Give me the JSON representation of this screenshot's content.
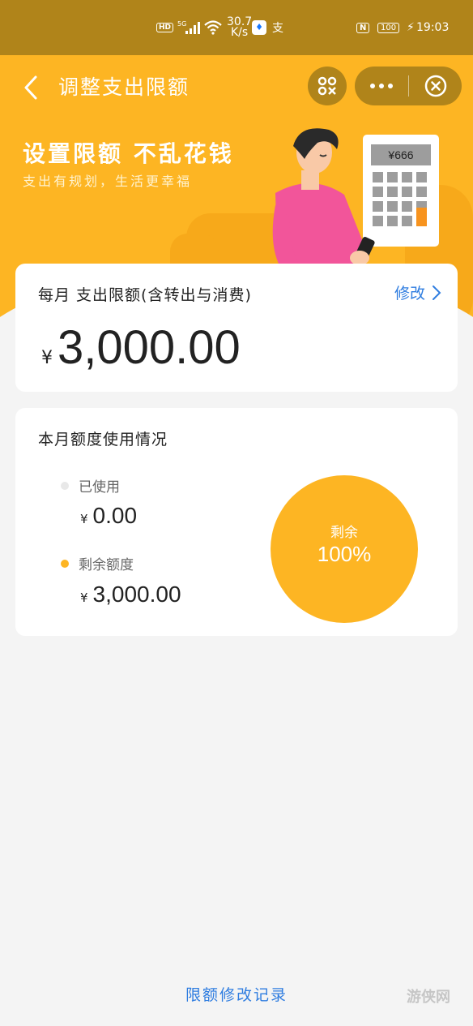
{
  "status_bar": {
    "hd": "HD",
    "network": "5G",
    "speed_value": "30.7",
    "speed_unit": "K/s",
    "app_icon_2": "支",
    "nfc": "N",
    "battery": "100",
    "time": "19:03"
  },
  "nav": {
    "title": "调整支出限额"
  },
  "banner": {
    "title": "设置限额 不乱花钱",
    "subtitle": "支出有规划，生活更幸福",
    "calculator_display": "¥666"
  },
  "limit_card": {
    "label": "每月 支出限额(含转出与消费)",
    "edit_label": "修改",
    "currency": "¥",
    "amount": "3,000.00"
  },
  "usage_card": {
    "title": "本月额度使用情况",
    "used_label": "已使用",
    "used_currency": "¥",
    "used_amount": "0.00",
    "remain_label": "剩余额度",
    "remain_currency": "¥",
    "remain_amount": "3,000.00",
    "ring_label": "剩余",
    "ring_value": "100%",
    "remaining_fraction": 1.0
  },
  "footer": {
    "history_link": "限额修改记录",
    "watermark": "游侠网"
  },
  "colors": {
    "accent": "#fdb523",
    "status_bar": "#b0841a",
    "link": "#2f7de0",
    "background": "#f4f4f4"
  }
}
